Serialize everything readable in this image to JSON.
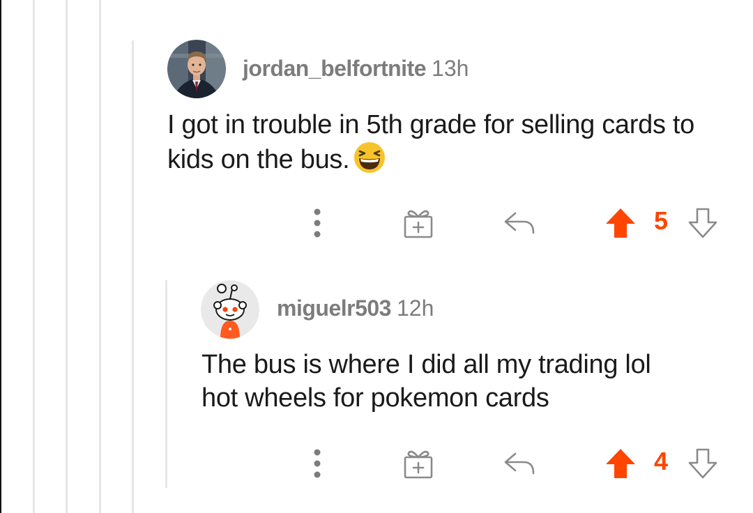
{
  "colors": {
    "accent": "#ff4500",
    "meta_text": "#7c7c7c",
    "thread_line": "#e6e6e6",
    "icon_gray": "#8a8a8a"
  },
  "comments": [
    {
      "username": "jordan_belfortnite",
      "time": "13h",
      "body": "I got in trouble in 5th grade for selling cards to kids on the bus.",
      "emoji": "laughing-squinting-emoji",
      "votes": "5",
      "icons": {
        "more": "more-vertical-icon",
        "award": "gift-icon",
        "reply": "reply-arrow-icon",
        "upvote": "upvote-arrow-icon",
        "downvote": "downvote-arrow-icon"
      }
    },
    {
      "username": "miguelr503",
      "time": "12h",
      "body_line1": "The bus is where I did all my trading lol",
      "body_line2": "hot wheels for pokemon cards",
      "votes": "4",
      "icons": {
        "more": "more-vertical-icon",
        "award": "gift-icon",
        "reply": "reply-arrow-icon",
        "upvote": "upvote-arrow-icon",
        "downvote": "downvote-arrow-icon"
      }
    }
  ]
}
